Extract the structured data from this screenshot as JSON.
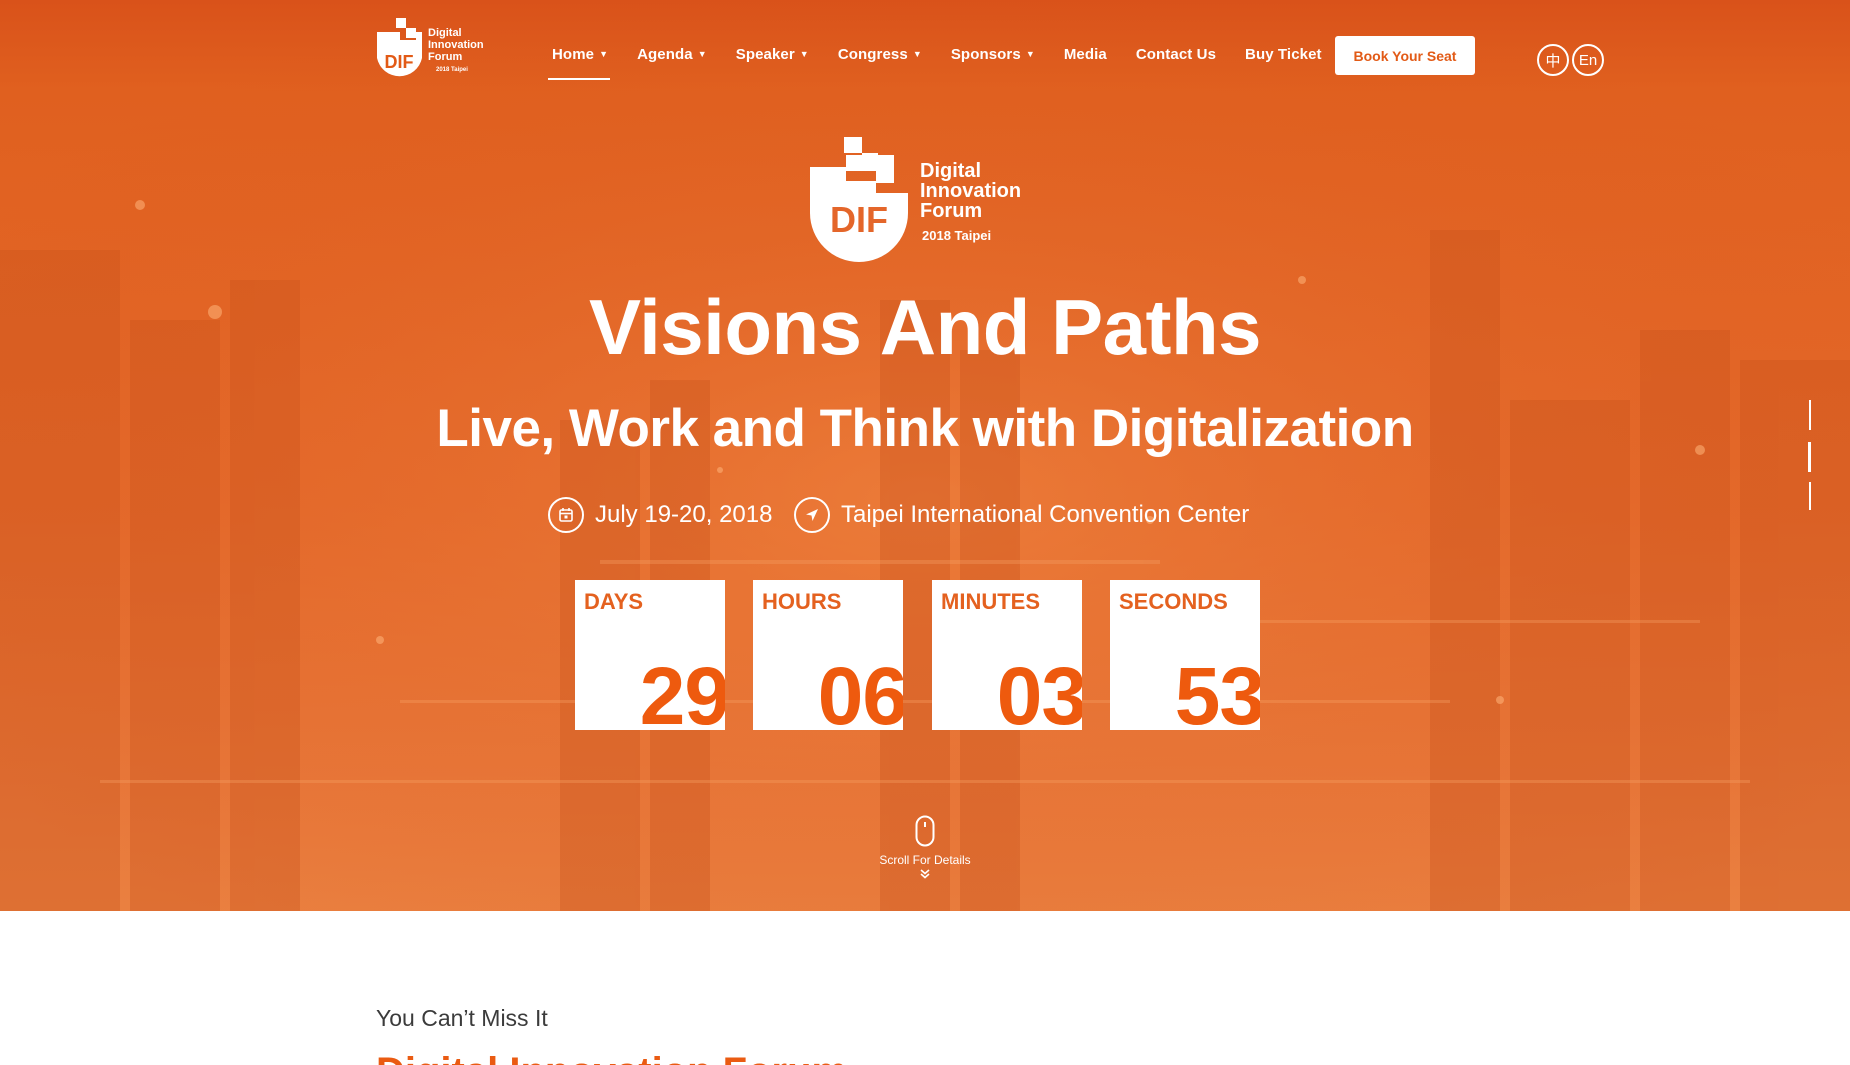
{
  "brand": {
    "logo_mark": "DIF",
    "logo_lines": [
      "Digital",
      "Innovation",
      "Forum"
    ],
    "logo_edition": "2018 Taipei"
  },
  "nav": {
    "items": [
      {
        "label": "Home",
        "has_dropdown": true,
        "active": true
      },
      {
        "label": "Agenda",
        "has_dropdown": true
      },
      {
        "label": "Speaker",
        "has_dropdown": true
      },
      {
        "label": "Congress",
        "has_dropdown": true
      },
      {
        "label": "Sponsors",
        "has_dropdown": true
      },
      {
        "label": "Media",
        "has_dropdown": false
      },
      {
        "label": "Contact Us",
        "has_dropdown": false
      },
      {
        "label": "Buy Ticket",
        "has_dropdown": false
      }
    ],
    "cta_label": "Book Your Seat",
    "lang_zh": "中",
    "lang_en": "En"
  },
  "hero": {
    "headline": "Visions And Paths",
    "subline": "Live, Work and Think with Digitalization",
    "date": "July 19-20, 2018",
    "venue": "Taipei International Convention Center",
    "countdown": [
      {
        "label": "DAYS",
        "value": "29"
      },
      {
        "label": "HOURS",
        "value": "06"
      },
      {
        "label": "MINUTES",
        "value": "03"
      },
      {
        "label": "SECONDS",
        "value": "53"
      }
    ],
    "scroll_label": "Scroll For Details"
  },
  "section": {
    "sub_heading": "You Can’t Miss It",
    "title": "Digital Innovation Forum"
  },
  "colors": {
    "accent": "#e25a16",
    "hero_orange": "#e4692a",
    "white": "#ffffff"
  },
  "icons": {
    "date": "calendar-icon",
    "venue": "location-arrow-icon",
    "scroll": "mouse-icon",
    "dropdown": "chevron-down-icon"
  }
}
